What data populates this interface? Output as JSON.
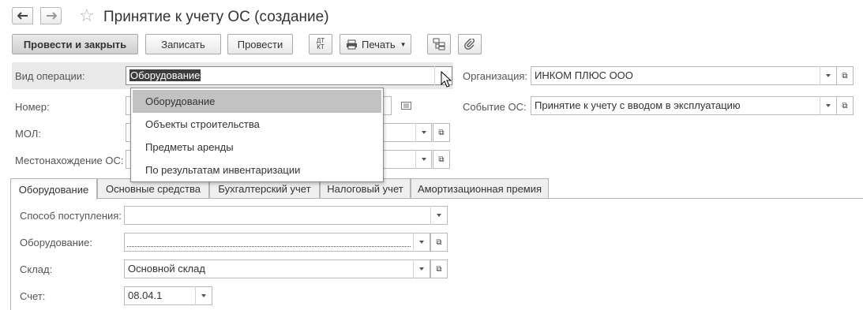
{
  "window": {
    "title": "Принятие к учету ОС (создание)",
    "back_icon": "arrow-left-icon",
    "forward_icon": "arrow-right-icon",
    "favorite_icon": "star-icon"
  },
  "toolbar": {
    "post_close": "Провести и закрыть",
    "save": "Записать",
    "post": "Провести",
    "dtkt_line1": "ДТ",
    "dtkt_line2": "КТ",
    "print": "Печать",
    "structure_icon": "document-structure-icon",
    "attach_icon": "paperclip-icon"
  },
  "form": {
    "operation": {
      "label": "Вид операции:",
      "value": "Оборудование"
    },
    "number": {
      "label": "Номер:",
      "value": ""
    },
    "mol": {
      "label": "МОЛ:",
      "value": ""
    },
    "location": {
      "label": "Местонахождение ОС:",
      "value": ""
    },
    "organization": {
      "label": "Организация:",
      "value": "ИНКОМ ПЛЮС ООО"
    },
    "event": {
      "label": "Событие ОС:",
      "value": "Принятие к учету с вводом в эксплуатацию"
    }
  },
  "dropdown": {
    "items": [
      {
        "label": "Оборудование",
        "selected": true
      },
      {
        "label": "Объекты строительства",
        "selected": false
      },
      {
        "label": "Предметы аренды",
        "selected": false
      },
      {
        "label": "По результатам инвентаризации",
        "selected": false
      }
    ]
  },
  "tabs": [
    {
      "label": "Оборудование",
      "active": true
    },
    {
      "label": "Основные средства",
      "active": false
    },
    {
      "label": "Бухгалтерский учет",
      "active": false
    },
    {
      "label": "Налоговый учет",
      "active": false
    },
    {
      "label": "Амортизационная премия",
      "active": false
    }
  ],
  "tab_content": {
    "receipt_method": {
      "label": "Способ поступления:",
      "value": ""
    },
    "equipment": {
      "label": "Оборудование:",
      "value": ""
    },
    "warehouse": {
      "label": "Склад:",
      "value": "Основной склад"
    },
    "account": {
      "label": "Счет:",
      "value": "08.04.1"
    }
  }
}
